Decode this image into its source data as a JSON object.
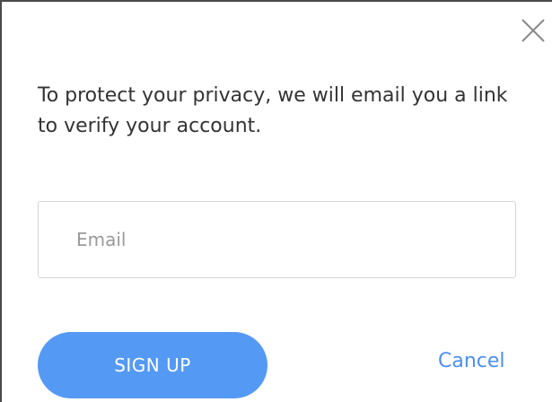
{
  "dialog": {
    "close_icon": "close-icon",
    "message": "To protect your privacy, we will email you a link to verify your account.",
    "email": {
      "value": "",
      "placeholder": "Email"
    },
    "signup_label": "SIGN UP",
    "cancel_label": "Cancel"
  },
  "colors": {
    "primary": "#5499f4",
    "link": "#4b8ff0",
    "text": "#333333",
    "placeholder": "#9a9a9a",
    "border": "#d6d6d6"
  }
}
